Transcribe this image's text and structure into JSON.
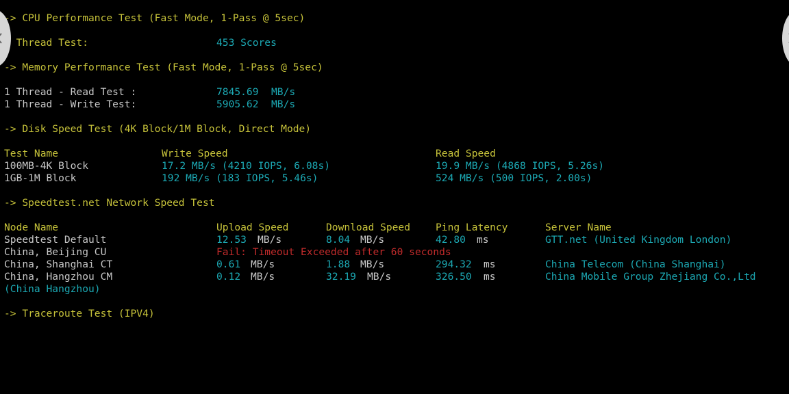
{
  "cpu": {
    "header": "-> CPU Performance Test (Fast Mode, 1-Pass @ 5sec)",
    "label": "1 Thread Test:",
    "value": "453 Scores"
  },
  "memory": {
    "header": "-> Memory Performance Test (Fast Mode, 1-Pass @ 5sec)",
    "rows": [
      {
        "label": "1 Thread - Read Test :",
        "value": "7845.69",
        "unit": "MB/s"
      },
      {
        "label": "1 Thread - Write Test:",
        "value": "5905.62",
        "unit": "MB/s"
      }
    ]
  },
  "disk": {
    "header": "-> Disk Speed Test (4K Block/1M Block, Direct Mode)",
    "columns": [
      "Test Name",
      "Write Speed",
      "Read Speed"
    ],
    "rows": [
      {
        "name": "100MB-4K Block",
        "write": "17.2 MB/s (4210 IOPS, 6.08s)",
        "read": "19.9 MB/s (4868 IOPS, 5.26s)"
      },
      {
        "name": "1GB-1M Block",
        "write": "192 MB/s (183 IOPS, 5.46s)",
        "read": "524 MB/s (500 IOPS, 2.00s)"
      }
    ]
  },
  "network": {
    "header": "-> Speedtest.net Network Speed Test",
    "columns": [
      "Node Name",
      "Upload Speed",
      "Download Speed",
      "Ping Latency",
      "Server Name"
    ],
    "rows": [
      {
        "node": "Speedtest Default",
        "upload": "12.53",
        "upload_unit": "MB/s",
        "download": "8.04",
        "download_unit": "MB/s",
        "ping": "42.80",
        "ping_unit": "ms",
        "server": "GTT.net (United Kingdom London)"
      },
      {
        "node": "China, Beijing CU",
        "fail": "Fail: Timeout Exceeded after 60 seconds"
      },
      {
        "node": "China, Shanghai CT",
        "upload": "0.61",
        "upload_unit": "MB/s",
        "download": "1.88",
        "download_unit": "MB/s",
        "ping": "294.32",
        "ping_unit": "ms",
        "server": "China Telecom (China Shanghai)"
      },
      {
        "node": "China, Hangzhou CM",
        "upload": "0.12",
        "upload_unit": "MB/s",
        "download": "32.19",
        "download_unit": "MB/s",
        "ping": "326.50",
        "ping_unit": "ms",
        "server": "China Mobile Group Zhejiang Co.,Ltd",
        "server_wrap": "(China Hangzhou)"
      }
    ]
  },
  "next_header_partial": "-> Traceroute Test (IPV4)",
  "colors": {
    "background": "#000000",
    "header": "#c6c23a",
    "label": "#c8c8c8",
    "value": "#1ca9b4",
    "error": "#c12b2b"
  },
  "icons": {
    "left_nav": "chevron-left-icon",
    "right_nav": "chevron-right-icon"
  }
}
